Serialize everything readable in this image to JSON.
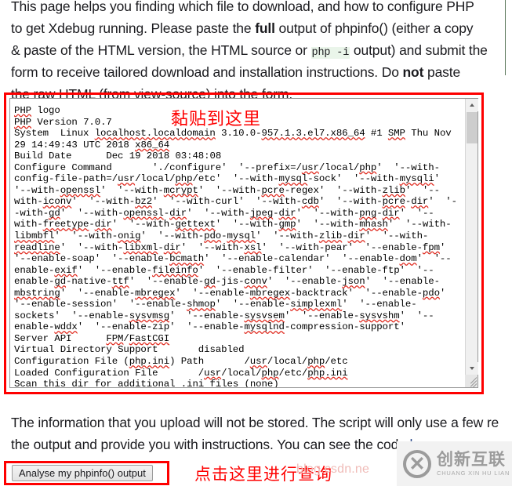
{
  "intro": {
    "line1": "This page helps you finding which file to download, and how to configure PHP",
    "line2_a": "to get Xdebug running. Please paste the ",
    "line2_bold": "full",
    "line2_b": " output of phpinfo() (either a copy",
    "line3_a": "& paste of the HTML version, the HTML source or ",
    "line3_code": "php -i",
    "line3_b": " output) and submit the",
    "line4_a": "form to receive tailored download and installation instructions. Do ",
    "line4_bold": "not",
    "line4_b": " paste",
    "line5": "the raw HTML (from view-source) into the form."
  },
  "textarea": {
    "value": "PHP logo\nPHP Version 7.0.7\nSystem  Linux localhost.localdomain 3.10.0-957.1.3.el7.x86_64 #1 SMP Thu Nov 29 14:49:43 UTC 2018 x86_64\nBuild Date      Dec 19 2018 03:48:08\nConfigure Command       './configure'  '--prefix=/usr/local/php'  '--with-config-file-path=/usr/local/php/etc'  '--with-mysql-sock'  '--with-mysqli'  '--with-openssl'  '--with-mcrypt'  '--with-pcre-regex'  '--with-zlib'  '--with-iconv'  '--with-bz2'  '--with-curl'  '--with-cdb'  '--with-pcre-dir'  '--with-gd'  '--with-openssl-dir'  '--with-jpeg-dir'  '--with-png-dir'  '--with-freetype-dir'  '--with-gettext'  '--with-gmp'  '--with-mhash'  '--with-libmbfl'  '--with-onig'  '--with-pdo-mysql'  '--with-zlib-dir'  '--with-readline'  '--with-libxml-dir'  '--with-xsl'  '--with-pear'  '--enable-fpm'  '--enable-soap'  '--enable-bcmath'  '--enable-calendar'  '--enable-dom'  '--enable-exif'  '--enable-fileinfo'  '--enable-filter'  '--enable-ftp'  '--enable-gd-native-ttf'  '--enable-gd-jis-conv'  '--enable-json'  '--enable-mbstring'  '--enable-mbregex'  '--enable-mbregex-backtrack'  '--enable-pdo'  '--enable-session'  '--enable-shmop'  '--enable-simplexml'  '--enable-sockets'  '--enable-sysvmsg'  '--enable-sysvsem'  '--enable-sysvshm'  '--enable-wddx'  '--enable-zip'  '--enable-mysqlnd-compression-support'\nServer API      FPM/FastCGI\nVirtual Directory Support       disabled\nConfiguration File (php.ini) Path       /usr/local/php/etc\nLoaded Configuration File       /usr/local/php/etc/php.ini\nScan this dir for additional .ini files (none)",
    "lines": [
      "PHP logo",
      "PHP Version 7.0.7",
      "System  Linux localhost.localdomain 3.10.0-957.1.3.el7.x86_64 #1 SMP Thu Nov 29 14:49:43 UTC 2018 x86_64",
      "Build Date      Dec 19 2018 03:48:08",
      "Configure Command       './configure'  '--prefix=/usr/local/php'  '--with-config-file-path=/usr/local/php/etc'  '--with-mysql-sock'  '--with-mysqli'  '--with-openssl'  '--with-mcrypt'  '--with-pcre-regex'  '--with-zlib'  '--with-iconv'  '--with-bz2'  '--with-curl'  '--with-cdb'  '--with-pcre-dir'  '--with-gd'  '--with-openssl-dir'  '--with-jpeg-dir'  '--with-png-dir'  '--with-freetype-dir'  '--with-gettext'  '--with-gmp'  '--with-mhash'  '--with-libmbfl'  '--with-onig'  '--with-pdo-mysql'  '--with-zlib-dir'  '--with-readline'  '--with-libxml-dir'  '--with-xsl'  '--with-pear'  '--enable-fpm'  '--enable-soap'  '--enable-bcmath'  '--enable-calendar'  '--enable-dom'  '--enable-exif'  '--enable-fileinfo'  '--enable-filter'  '--enable-ftp'  '--enable-gd-native-ttf'  '--enable-gd-jis-conv'  '--enable-json'  '--enable-mbstring'  '--enable-mbregex'  '--enable-mbregex-backtrack'  '--enable-pdo'  '--enable-session'  '--enable-shmop'  '--enable-simplexml'  '--enable-sockets'  '--enable-sysvmsg'  '--enable-sysvsem'  '--enable-sysvshm'  '--enable-wddx'  '--enable-zip'  '--enable-mysqlnd-compression-support'",
      "Server API      FPM/FastCGI",
      "Virtual Directory Support       disabled",
      "Configuration File (php.ini) Path       /usr/local/php/etc",
      "Loaded Configuration File       /usr/local/php/etc/php.ini",
      "Scan this dir for additional .ini files (none)"
    ]
  },
  "annotations": {
    "paste_here": "黏贴到这里",
    "click_here": "点击这里进行查询",
    "color": "#fe0000"
  },
  "outro": {
    "line1": "The information that you upload will not be stored. The script will only use a few re",
    "line2_a": "the output and provide you with instructions. You can see the code ",
    "line2_link": "here"
  },
  "button": {
    "label": "Analyse my phpinfo() output"
  },
  "watermarks": {
    "csdn": "blog.csdn.ne",
    "brand_cn": "创新互联",
    "brand_en": "CHUANG XIN HU LIAN",
    "brand_mark": "✕"
  }
}
